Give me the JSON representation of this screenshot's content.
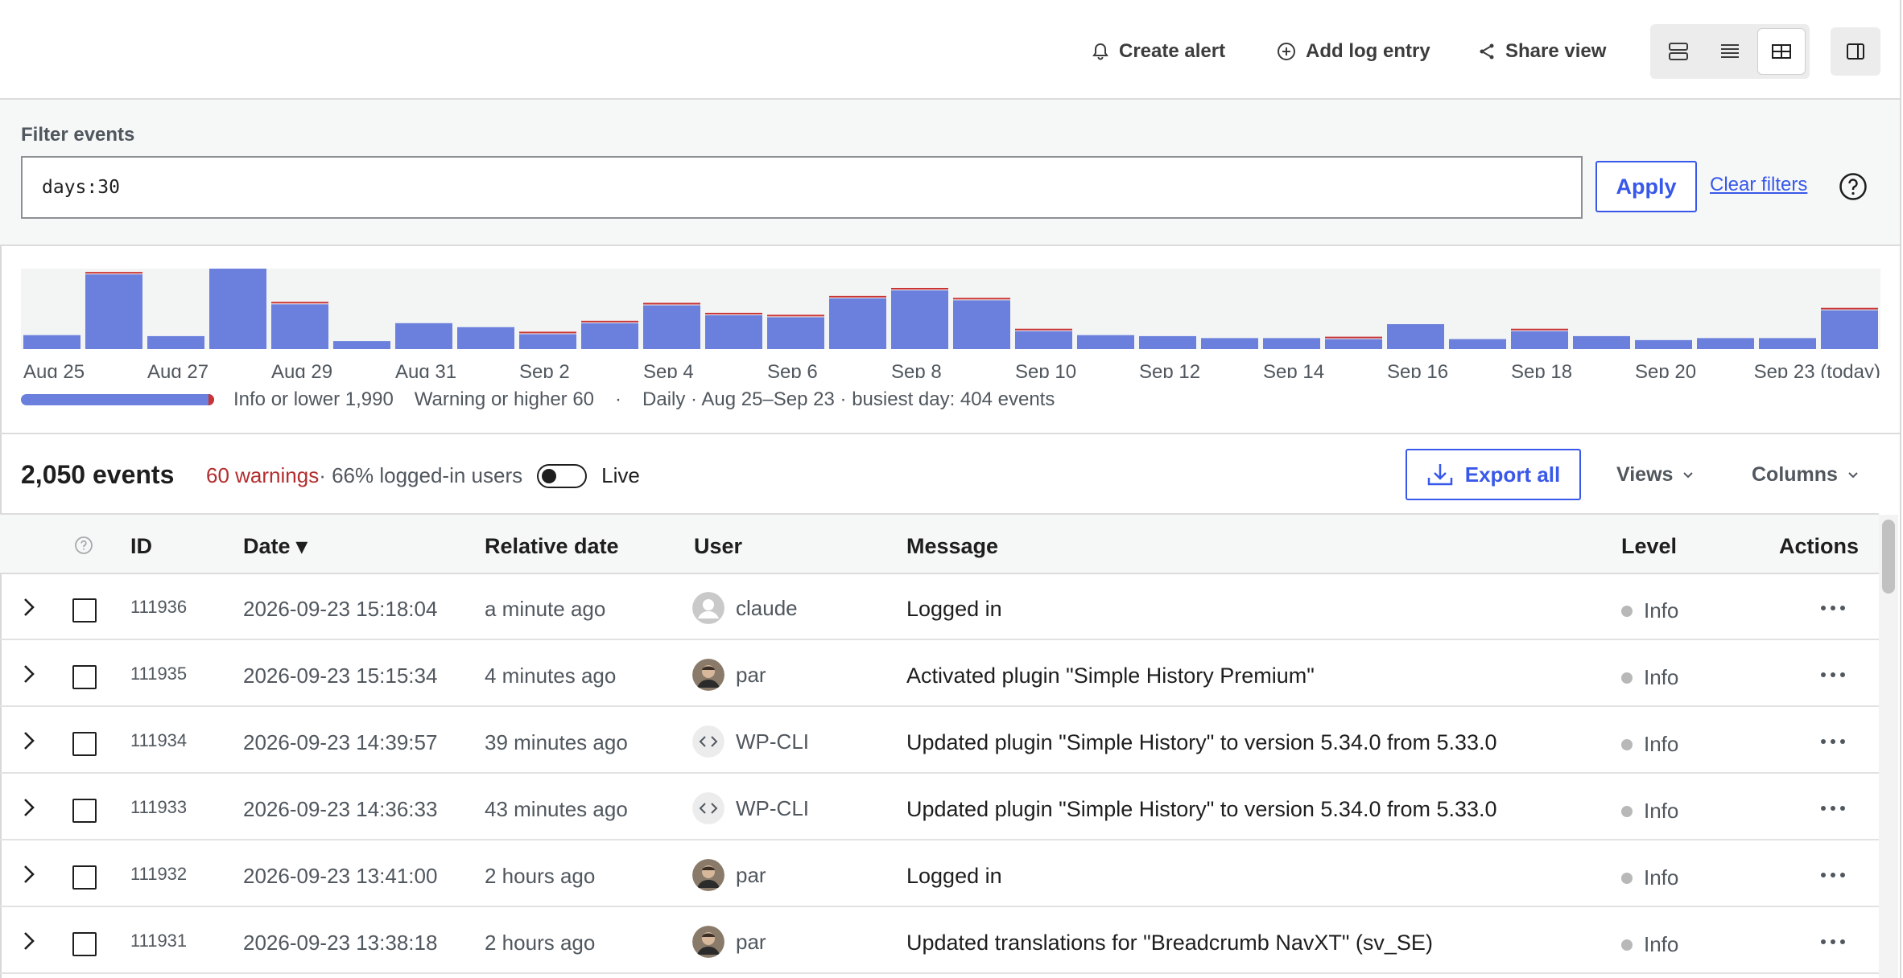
{
  "toolbar": {
    "create_alert": "Create alert",
    "add_log_entry": "Add log entry",
    "share_view": "Share view"
  },
  "filter": {
    "label": "Filter events",
    "value": "days:30",
    "apply": "Apply",
    "clear": "Clear filters"
  },
  "chart_data": {
    "type": "bar",
    "categories": [
      "Aug 25",
      "Aug 26",
      "Aug 27",
      "Aug 28",
      "Aug 29",
      "Aug 30",
      "Aug 31",
      "Sep 1",
      "Sep 2",
      "Sep 3",
      "Sep 4",
      "Sep 5",
      "Sep 6",
      "Sep 7",
      "Sep 8",
      "Sep 9",
      "Sep 10",
      "Sep 11",
      "Sep 12",
      "Sep 13",
      "Sep 14",
      "Sep 15",
      "Sep 16",
      "Sep 17",
      "Sep 18",
      "Sep 19",
      "Sep 20",
      "Sep 21",
      "Sep 22",
      "Sep 23"
    ],
    "tick_labels": [
      "Aug 25",
      "Aug 27",
      "Aug 29",
      "Aug 31",
      "Sep 2",
      "Sep 4",
      "Sep 6",
      "Sep 8",
      "Sep 10",
      "Sep 12",
      "Sep 14",
      "Sep 16",
      "Sep 18",
      "Sep 20",
      "Sep 23 (today)"
    ],
    "series": [
      {
        "name": "Info or lower",
        "values": [
          70,
          375,
          65,
          404,
          225,
          40,
          130,
          110,
          75,
          130,
          220,
          170,
          160,
          255,
          295,
          245,
          90,
          70,
          65,
          55,
          55,
          50,
          125,
          50,
          90,
          65,
          45,
          55,
          55,
          195
        ]
      },
      {
        "name": "Warning or higher",
        "values": [
          0,
          12,
          0,
          0,
          10,
          0,
          0,
          0,
          6,
          4,
          10,
          6,
          4,
          8,
          6,
          6,
          4,
          0,
          0,
          0,
          0,
          6,
          0,
          0,
          8,
          0,
          0,
          0,
          0,
          8
        ]
      }
    ],
    "ylim": [
      0,
      404
    ],
    "colors": {
      "info": "#6b80dc",
      "warning": "#c93434"
    }
  },
  "summary": {
    "info_label": "Info or lower 1,990",
    "warning_label": "Warning or higher 60",
    "separator": "·",
    "range_text": "Daily · Aug 25–Sep 23 · busiest day: 404 events",
    "warning_fraction": 0.029
  },
  "counts": {
    "events": "2,050 events",
    "warnings": "60 warnings",
    "rest": " · 66% logged-in users",
    "live": "Live",
    "export": "Export all",
    "views": "Views",
    "columns": "Columns"
  },
  "table": {
    "headers": {
      "id": "ID",
      "date": "Date ▾",
      "relative": "Relative date",
      "user": "User",
      "message": "Message",
      "level": "Level",
      "actions": "Actions"
    },
    "rows": [
      {
        "id": "111936",
        "date": "2026-09-23 15:18:04",
        "relative": "a minute ago",
        "user": "claude",
        "avatar": "default",
        "message": "Logged in",
        "level": "Info"
      },
      {
        "id": "111935",
        "date": "2026-09-23 15:15:34",
        "relative": "4 minutes ago",
        "user": "par",
        "avatar": "photo",
        "message": "Activated plugin \"Simple History Premium\"",
        "level": "Info"
      },
      {
        "id": "111934",
        "date": "2026-09-23 14:39:57",
        "relative": "39 minutes ago",
        "user": "WP-CLI",
        "avatar": "code",
        "message": "Updated plugin \"Simple History\" to version 5.34.0 from 5.33.0",
        "level": "Info"
      },
      {
        "id": "111933",
        "date": "2026-09-23 14:36:33",
        "relative": "43 minutes ago",
        "user": "WP-CLI",
        "avatar": "code",
        "message": "Updated plugin \"Simple History\" to version 5.34.0 from 5.33.0",
        "level": "Info"
      },
      {
        "id": "111932",
        "date": "2026-09-23 13:41:00",
        "relative": "2 hours ago",
        "user": "par",
        "avatar": "photo",
        "message": "Logged in",
        "level": "Info"
      },
      {
        "id": "111931",
        "date": "2026-09-23 13:38:18",
        "relative": "2 hours ago",
        "user": "par",
        "avatar": "photo",
        "message": "Updated translations for \"Breadcrumb NavXT\" (sv_SE)",
        "level": "Info"
      }
    ]
  }
}
